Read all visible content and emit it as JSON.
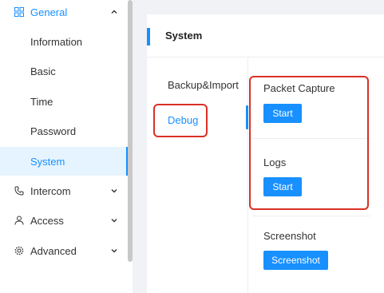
{
  "sidebar": {
    "general": {
      "label": "General"
    },
    "items": [
      {
        "label": "Information"
      },
      {
        "label": "Basic"
      },
      {
        "label": "Time"
      },
      {
        "label": "Password"
      },
      {
        "label": "System"
      }
    ],
    "intercom": {
      "label": "Intercom"
    },
    "access": {
      "label": "Access"
    },
    "advanced": {
      "label": "Advanced"
    }
  },
  "panel": {
    "title": "System",
    "tabs": [
      {
        "label": "Backup&Import"
      },
      {
        "label": "Debug"
      }
    ],
    "packet_capture": {
      "label": "Packet Capture",
      "button": "Start"
    },
    "logs": {
      "label": "Logs",
      "button": "Start"
    },
    "screenshot": {
      "label": "Screenshot",
      "button": "Screenshot"
    }
  },
  "colors": {
    "accent": "#1890ff",
    "highlight": "#d93025"
  }
}
